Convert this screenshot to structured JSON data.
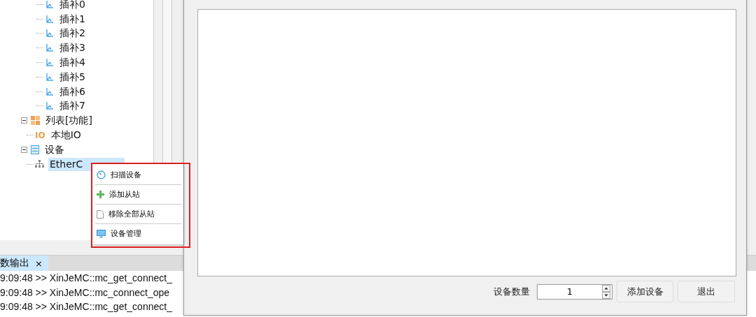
{
  "tree": {
    "items": [
      {
        "children": [
          {
            "label": "插补0",
            "kind": "axis"
          },
          {
            "label": "插补1",
            "kind": "axis"
          },
          {
            "label": "插补2",
            "kind": "axis"
          },
          {
            "label": "插补3",
            "kind": "axis"
          },
          {
            "label": "插补4",
            "kind": "axis"
          },
          {
            "label": "插补5",
            "kind": "axis"
          },
          {
            "label": "插补6",
            "kind": "axis"
          },
          {
            "label": "插补7",
            "kind": "axis"
          }
        ]
      },
      {
        "label": "列表[功能]",
        "kind": "grid",
        "expanded": true,
        "children": [
          {
            "label": "本地IO",
            "kind": "io",
            "icon_text": "IO"
          }
        ]
      },
      {
        "label": "设备",
        "kind": "list",
        "expanded": true,
        "children": [
          {
            "label": "EtherC",
            "kind": "network",
            "selected": true
          }
        ]
      }
    ]
  },
  "context_menu": {
    "items": [
      {
        "label": "扫描设备",
        "kind": "scan"
      },
      {
        "label": "添加从站",
        "kind": "add"
      },
      {
        "label": "移除全部从站",
        "kind": "document"
      },
      {
        "label": "设备管理",
        "kind": "monitor"
      }
    ]
  },
  "output": {
    "tab": {
      "label": "数输出",
      "close": "×",
      "selected": true
    },
    "lines": [
      {
        "time": "9:09:48",
        "text": ">> XinJeMC::mc_get_connect_"
      },
      {
        "time": "9:09:48",
        "text": ">> XinJeMC::mc_connect_ope"
      },
      {
        "time": "9:09:48",
        "text": ">> XinJeMC::mc_get_connect_"
      }
    ]
  },
  "dialog": {
    "count_label": "设备数量",
    "count_value": "1",
    "buttons": [
      "添加设备",
      "退出"
    ]
  }
}
